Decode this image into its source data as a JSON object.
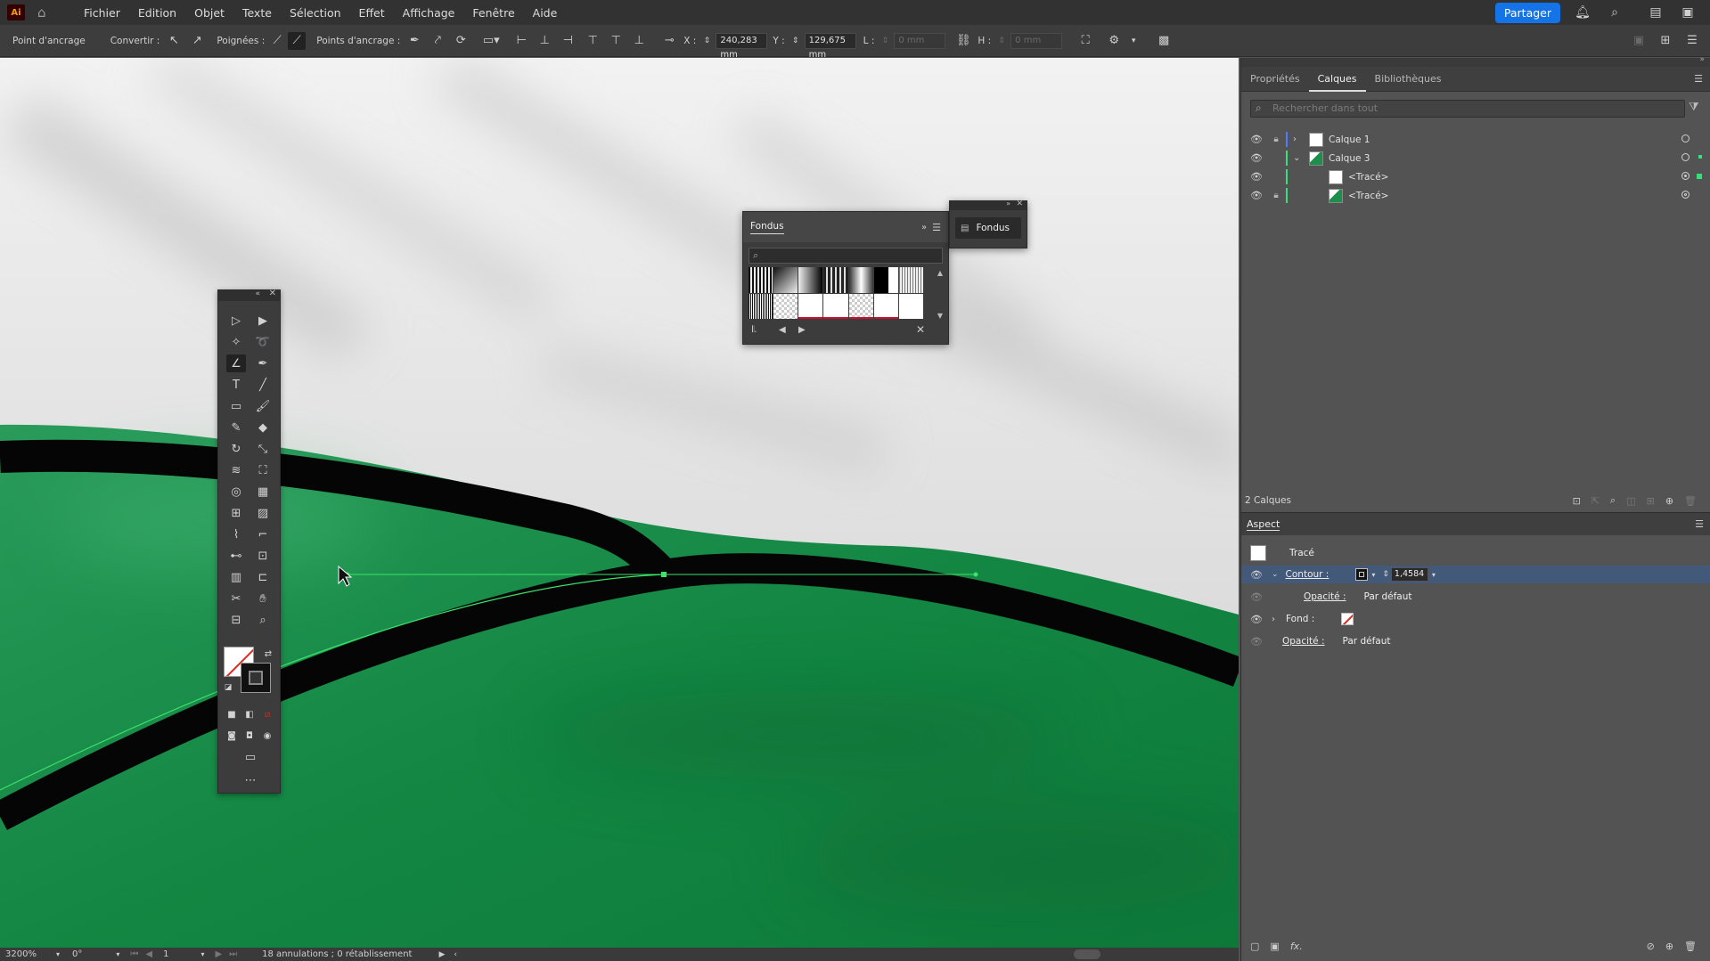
{
  "app": {
    "logo_text": "Ai",
    "menu": [
      "Fichier",
      "Edition",
      "Objet",
      "Texte",
      "Sélection",
      "Effet",
      "Affichage",
      "Fenêtre",
      "Aide"
    ],
    "share_label": "Partager"
  },
  "controlbar": {
    "anchor_label": "Point d'ancrage",
    "convert_label": "Convertir :",
    "handles_label": "Poignées :",
    "anchors_label": "Points d'ancrage :",
    "x_label": "X :",
    "x_value": "240,283 mm",
    "y_label": "Y :",
    "y_value": "129,675 mm",
    "w_label": "L :",
    "w_value": "0 mm",
    "h_label": "H :",
    "h_value": "0 mm"
  },
  "fondus": {
    "title": "Fondus",
    "mini_label": "Fondus"
  },
  "panels": {
    "tabs": [
      "Propriétés",
      "Calques",
      "Bibliothèques"
    ],
    "active_tab": "Calques",
    "search_placeholder": "Rechercher dans tout",
    "layers": [
      {
        "name": "Calque 1",
        "color": "#4f7cff",
        "expanded": false,
        "locked": true
      },
      {
        "name": "Calque 3",
        "color": "#36e07b",
        "expanded": true,
        "locked": false
      },
      {
        "name": "<Tracé>",
        "color": "#36e07b",
        "sub": true,
        "locked": false
      },
      {
        "name": "<Tracé>",
        "color": "#36e07b",
        "sub": true,
        "locked": true
      }
    ],
    "layers_count": "2 Calques"
  },
  "aspect": {
    "title": "Aspect",
    "object": "Tracé",
    "contour_label": "Contour :",
    "contour_value": "1,4584 p",
    "opacity_label": "Opacité :",
    "opacity_value": "Par défaut",
    "fill_label": "Fond :",
    "opacity2_label": "Opacité :",
    "opacity2_value": "Par défaut",
    "fx_label": "fx."
  },
  "status": {
    "zoom": "3200%",
    "rotation": "0°",
    "artboard": "1",
    "history": "18 annulations ; 0 rétablissement"
  },
  "colors": {
    "accent": "#1473e6",
    "green_art": "#168b45",
    "path_green": "#3be36a"
  }
}
